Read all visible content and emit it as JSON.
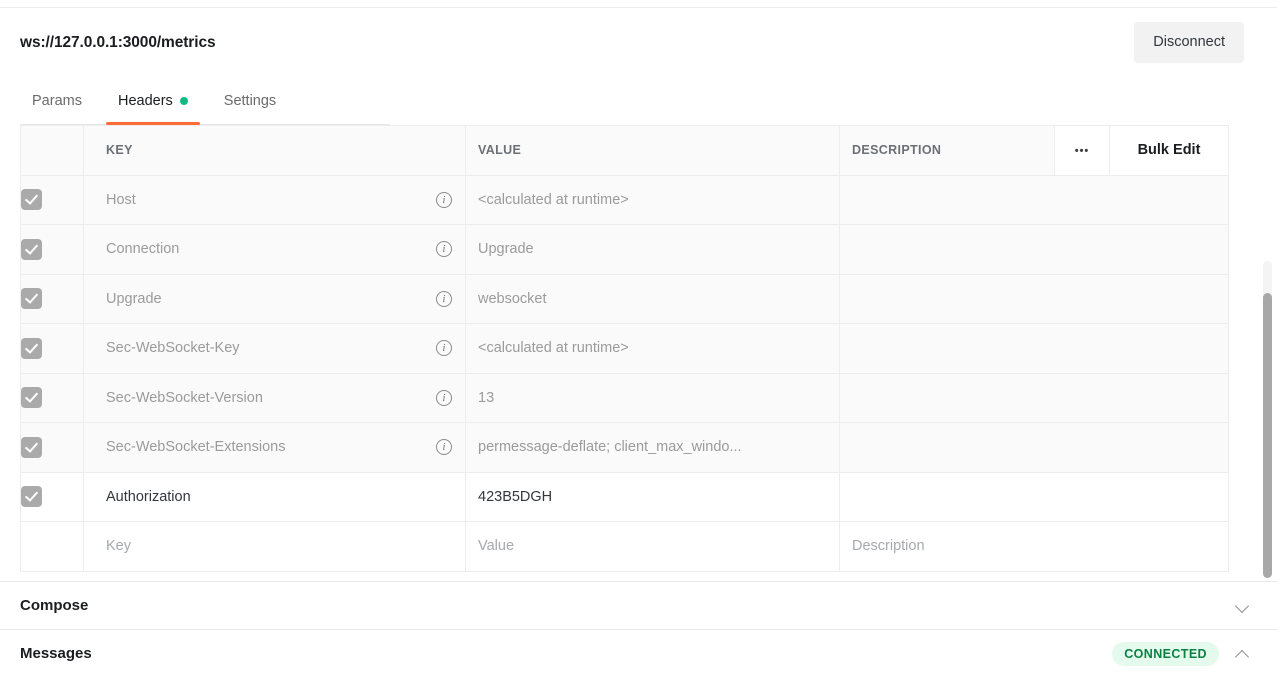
{
  "request": {
    "url": "ws://127.0.0.1:3000/metrics",
    "disconnect_label": "Disconnect"
  },
  "tabs": [
    {
      "label": "Params",
      "active": false,
      "dot": false
    },
    {
      "label": "Headers",
      "active": true,
      "dot": true
    },
    {
      "label": "Settings",
      "active": false,
      "dot": false
    }
  ],
  "table": {
    "columns": {
      "key": "KEY",
      "value": "VALUE",
      "description": "DESCRIPTION",
      "options_icon": "•••",
      "bulk_edit": "Bulk Edit"
    },
    "rows": [
      {
        "checked": true,
        "key": "Host",
        "value": "<calculated at runtime>",
        "description": "",
        "system": true,
        "info": true
      },
      {
        "checked": true,
        "key": "Connection",
        "value": "Upgrade",
        "description": "",
        "system": true,
        "info": true
      },
      {
        "checked": true,
        "key": "Upgrade",
        "value": "websocket",
        "description": "",
        "system": true,
        "info": true
      },
      {
        "checked": true,
        "key": "Sec-WebSocket-Key",
        "value": "<calculated at runtime>",
        "description": "",
        "system": true,
        "info": true
      },
      {
        "checked": true,
        "key": "Sec-WebSocket-Version",
        "value": "13",
        "description": "",
        "system": true,
        "info": true
      },
      {
        "checked": true,
        "key": "Sec-WebSocket-Extensions",
        "value": "permessage-deflate; client_max_windo...",
        "description": "",
        "system": true,
        "info": true
      },
      {
        "checked": true,
        "key": "Authorization",
        "value": "423B5DGH",
        "description": "",
        "system": false,
        "info": false,
        "highlighted": true
      }
    ],
    "placeholder_row": {
      "key": "Key",
      "value": "Value",
      "description": "Description"
    }
  },
  "panels": {
    "compose": {
      "title": "Compose",
      "chevron": "chevron-down"
    },
    "messages": {
      "title": "Messages",
      "status": "CONNECTED",
      "chevron": "chevron-up"
    }
  },
  "colors": {
    "accent": "#ff6c37",
    "connected": "#0b8043",
    "connected_bg": "#e4faec",
    "tab_dot": "#10b981",
    "highlight": "#fe0000"
  }
}
